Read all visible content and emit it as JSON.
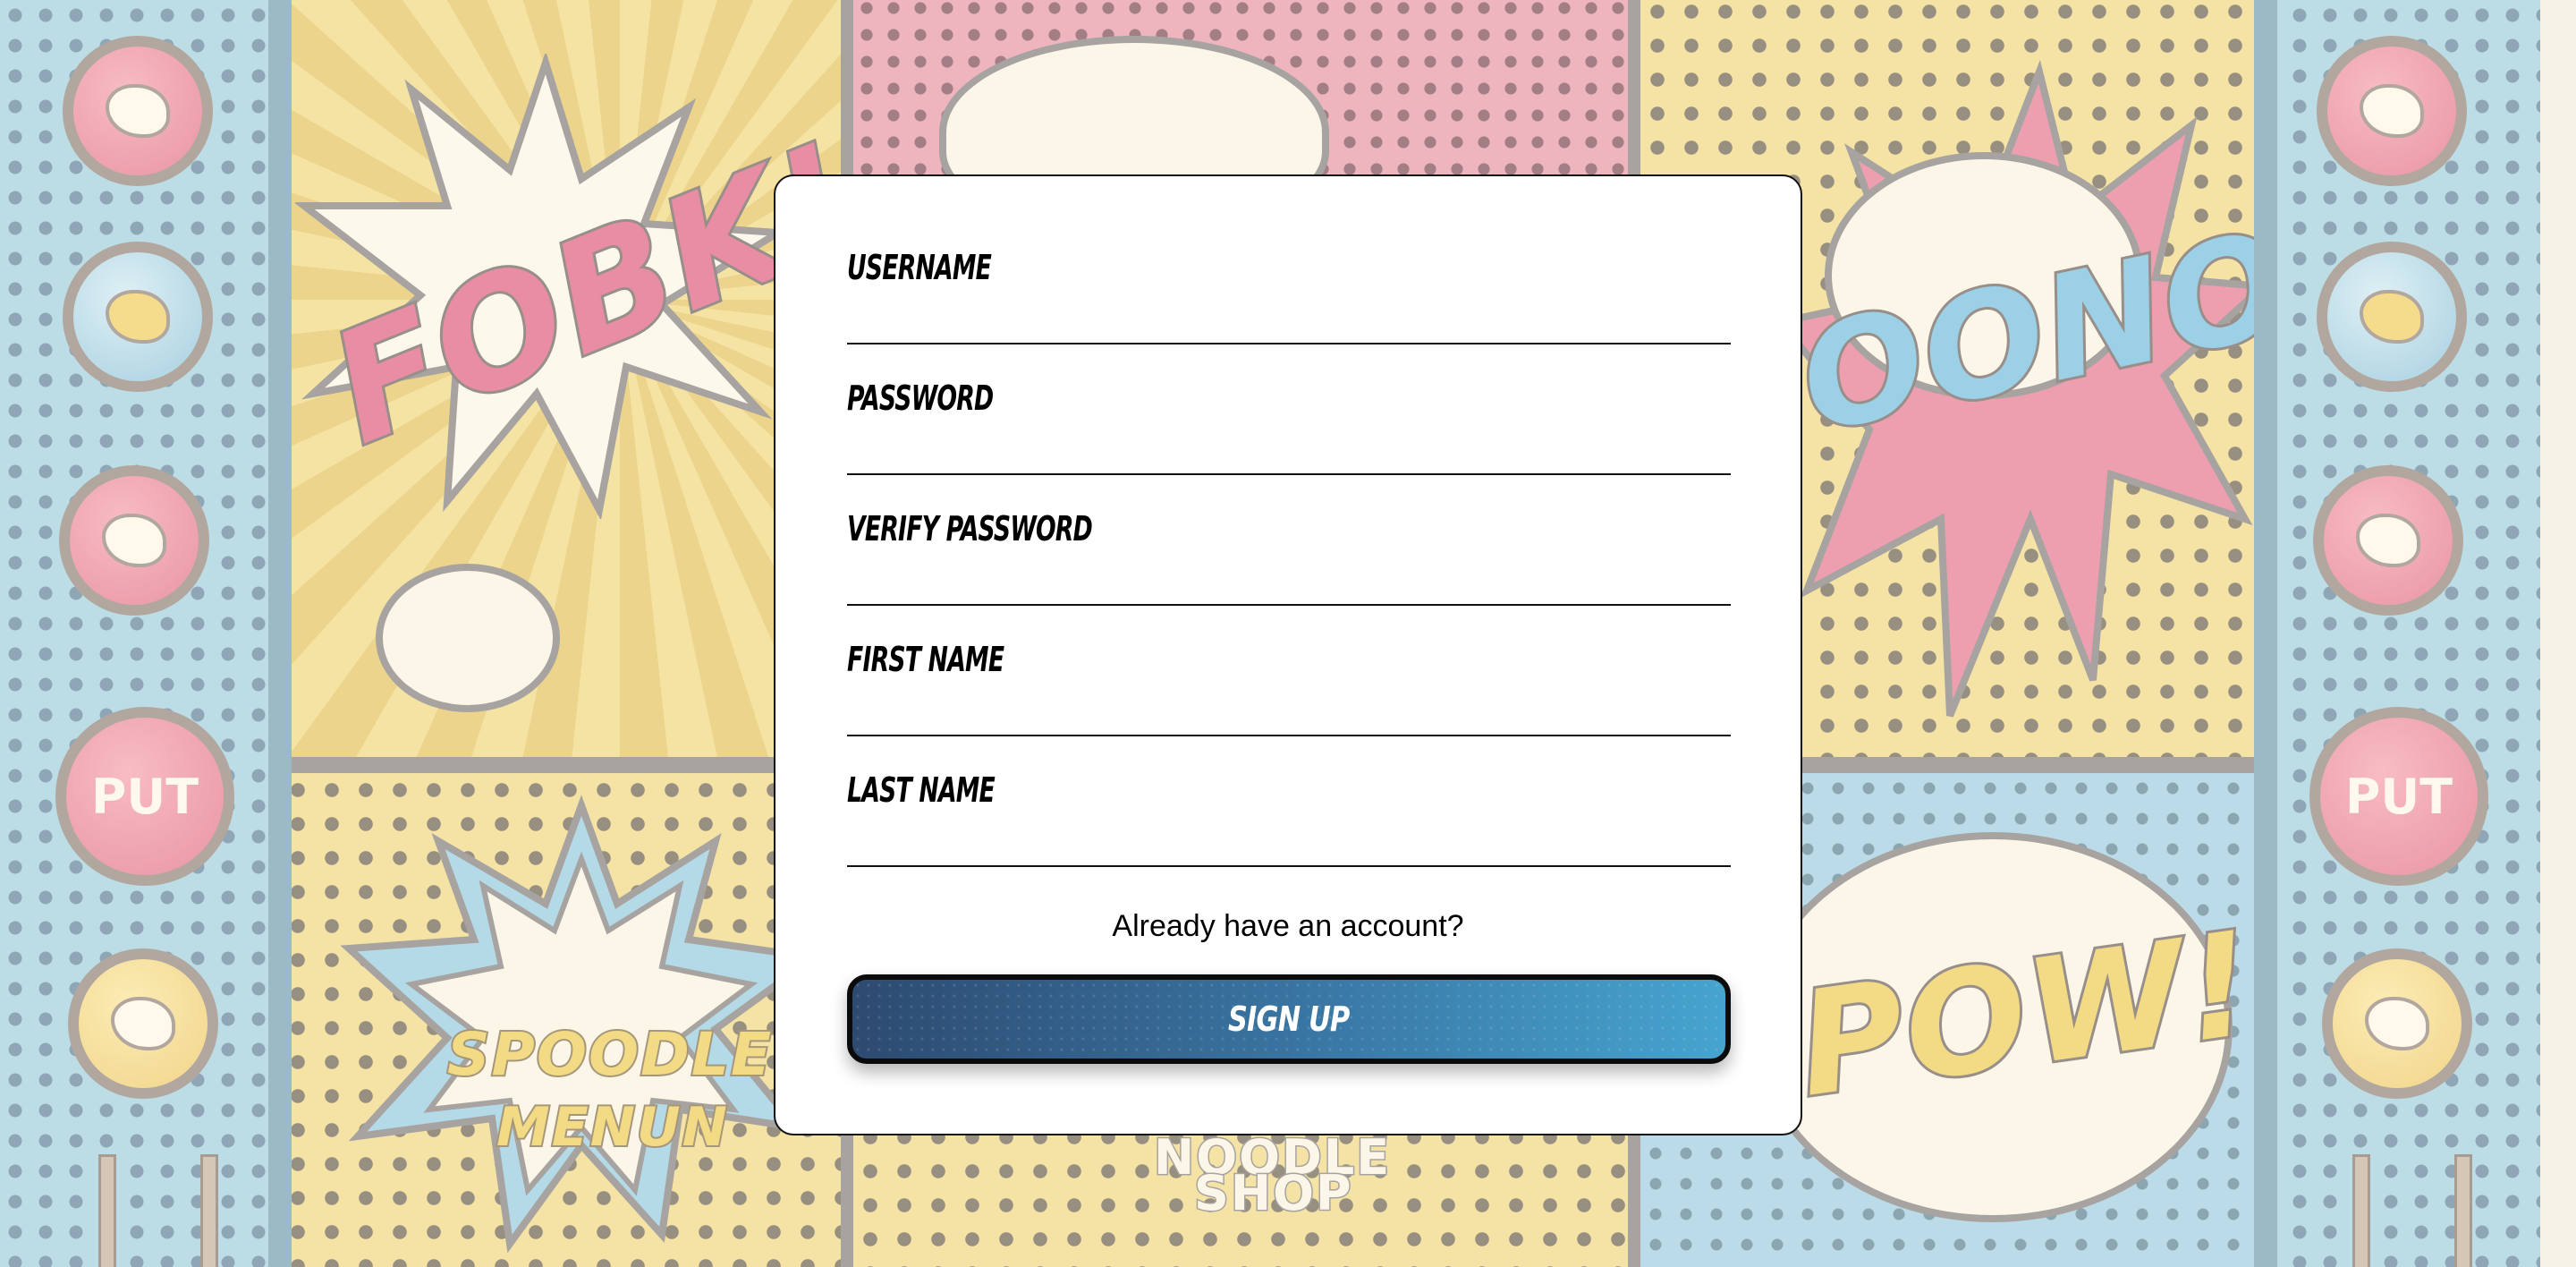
{
  "form": {
    "fields": [
      {
        "label": "USERNAME",
        "value": ""
      },
      {
        "label": "PASSWORD",
        "value": ""
      },
      {
        "label": "VERIFY PASSWORD",
        "value": ""
      },
      {
        "label": "FIRST NAME",
        "value": ""
      },
      {
        "label": "LAST NAME",
        "value": ""
      }
    ],
    "login_link": "Already have an account?",
    "submit_label": "SIGN UP"
  },
  "background": {
    "words": [
      "FOBK!",
      "OONO!",
      "POW!",
      "SPOODLE",
      "MENUN",
      "NOODLE",
      "SHOP"
    ],
    "buttons": [
      "PUT"
    ]
  },
  "colors": {
    "button_gradient_start": "#2d4a70",
    "button_gradient_end": "#46a4cf",
    "card_background": "#ffffff"
  }
}
